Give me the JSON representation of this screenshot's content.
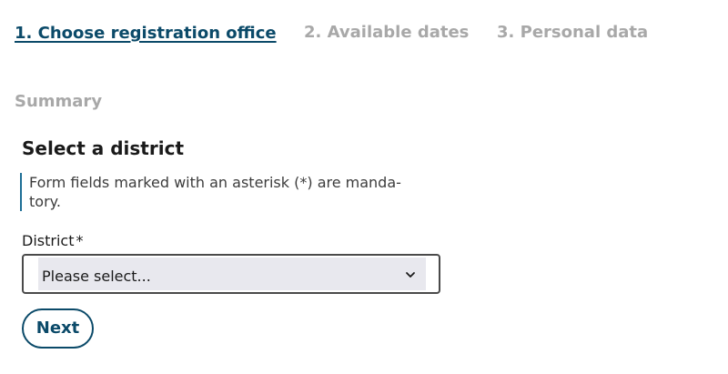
{
  "steps": [
    {
      "label": "1. Choose registration office",
      "active": true
    },
    {
      "label": "2. Available dates",
      "active": false
    },
    {
      "label": "3. Personal data",
      "active": false
    },
    {
      "label": "Summary",
      "active": false
    }
  ],
  "form": {
    "title": "Select a district",
    "hint": "Form fields marked with an asterisk (*) are manda-\ntory.",
    "district_label": "District",
    "required_marker": "*",
    "district_value": "Please select...",
    "next_label": "Next"
  },
  "colors": {
    "accent": "#0b4a69",
    "inactive_step": "#a8a8a8",
    "hint_border": "#1e6f96",
    "select_fill": "#e8e8ee"
  },
  "icons": {
    "select_chevron": "chevron-down-icon"
  }
}
